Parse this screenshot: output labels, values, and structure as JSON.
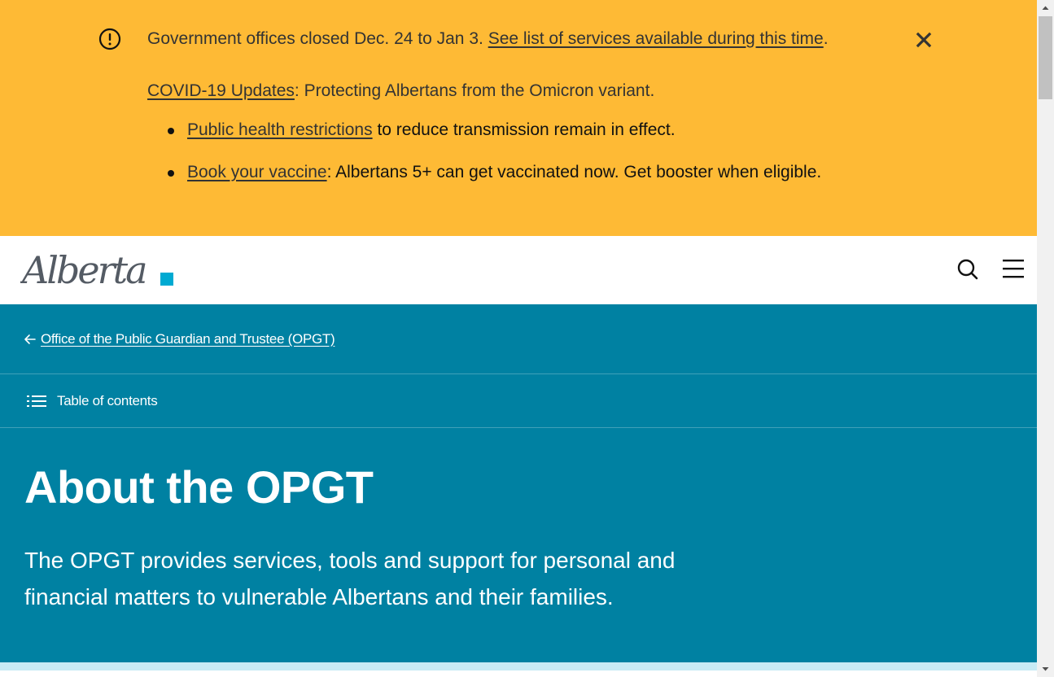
{
  "notice": {
    "closure_text": "Government offices closed Dec. 24 to Jan 3.",
    "closure_link": "See list of services available during this time",
    "closure_end": ".",
    "covid_link": "COVID-19 Updates",
    "covid_text": ": Protecting Albertans from the Omicron variant.",
    "bullets": [
      {
        "link": "Public health restrictions",
        "text": " to reduce transmission remain in effect."
      },
      {
        "link": "Book your vaccine",
        "text": ": Albertans 5+ can get vaccinated now. Get booster when eligible."
      }
    ],
    "background": "#feba35",
    "warning_icon": "alert-circle-icon",
    "close_icon": "close-icon"
  },
  "header": {
    "logo_text": "Alberta",
    "search_icon": "search-icon",
    "menu_icon": "hamburger-menu-icon"
  },
  "hero": {
    "background": "#0081a2",
    "breadcrumb": "Office of the Public Guardian and Trustee (OPGT)",
    "toc_label": "Table of contents",
    "title": "About the OPGT",
    "lead": "The OPGT provides services, tools and support for personal and financial matters to vulnerable Albertans and their families."
  },
  "colors": {
    "accent_cyan": "#00aad2",
    "text_dark": "#333333"
  }
}
